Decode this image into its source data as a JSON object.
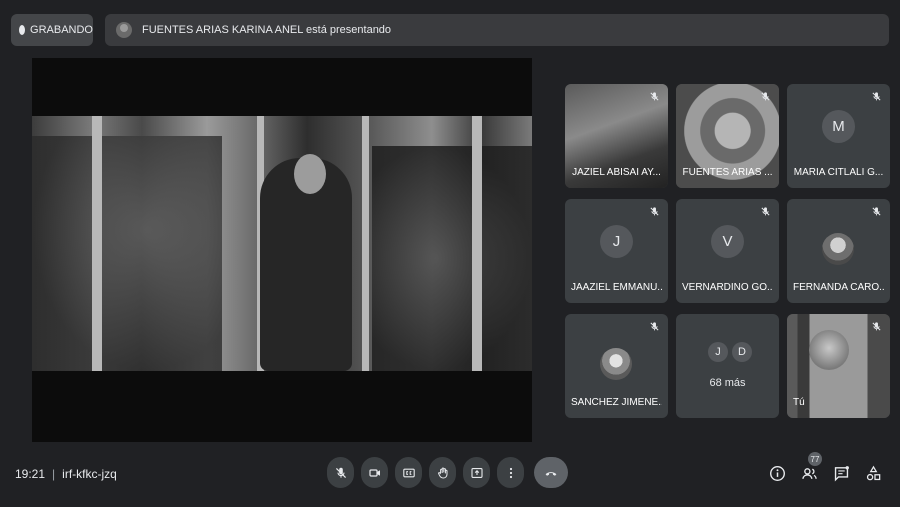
{
  "topbar": {
    "recording_label": "GRABANDO",
    "presenting_text": "FUENTES ARIAS KARINA ANEL está presentando"
  },
  "tiles": [
    {
      "name": "JAZIEL ABISAI AY...",
      "type": "camera"
    },
    {
      "name": "FUENTES ARIAS ...",
      "type": "camera"
    },
    {
      "name": "MARIA CITLALI G...",
      "type": "letter",
      "letter": "M"
    },
    {
      "name": "JAAZIEL EMMANU...",
      "type": "letter",
      "letter": "J"
    },
    {
      "name": "VERNARDINO GO...",
      "type": "letter",
      "letter": "V"
    },
    {
      "name": "FERNANDA CARO...",
      "type": "photo"
    },
    {
      "name": "SANCHEZ JIMENE...",
      "type": "photo"
    },
    {
      "name": "",
      "type": "more",
      "letters": [
        "J",
        "D"
      ],
      "more_text": "68 más"
    },
    {
      "name": "Tú",
      "type": "camera"
    }
  ],
  "bottombar": {
    "time": "19:21",
    "meeting_code": "irf-kfkc-jzq",
    "participants_count": "77"
  },
  "icons": {
    "mic": "mic-off-icon",
    "camera": "video-camera-icon",
    "captions": "closed-captions-icon",
    "hand": "raise-hand-icon",
    "present": "present-screen-icon",
    "more": "more-options-icon",
    "hangup": "hang-up-icon",
    "info": "info-icon",
    "people": "people-icon",
    "chat": "chat-icon",
    "activities": "activities-icon"
  }
}
